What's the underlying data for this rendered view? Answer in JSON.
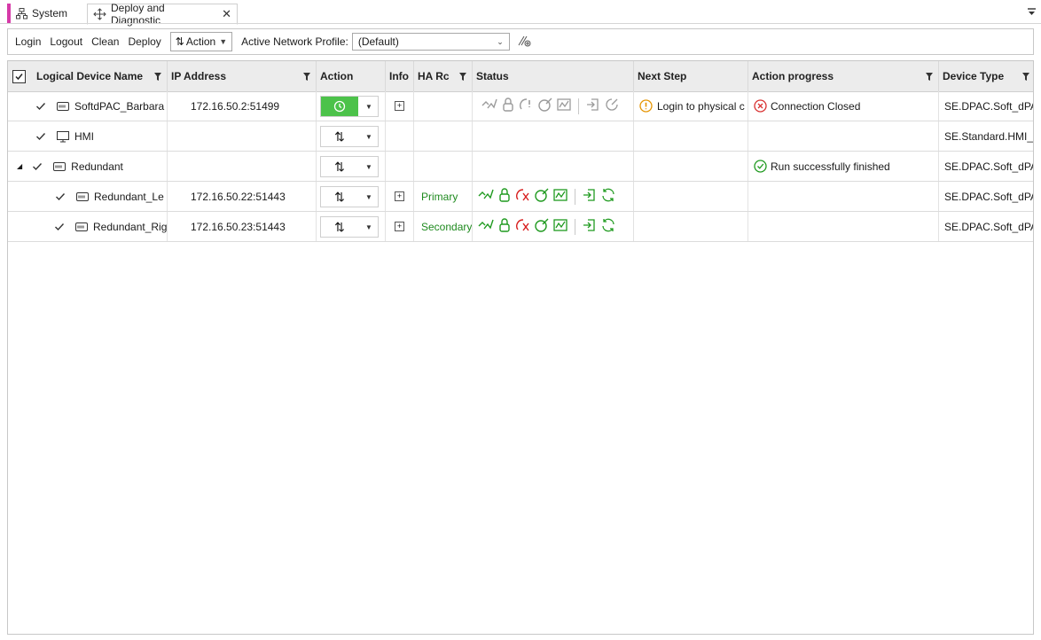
{
  "tabs": {
    "system": "System",
    "deploy": "Deploy and Diagnostic"
  },
  "toolbar": {
    "login": "Login",
    "logout": "Logout",
    "clean": "Clean",
    "deploy": "Deploy",
    "action": "Action",
    "profile_label": "Active Network Profile:",
    "profile_value": "(Default)"
  },
  "columns": {
    "name": "Logical Device Name",
    "ip": "IP Address",
    "action": "Action",
    "info": "Info",
    "ha": "HA Rc",
    "status": "Status",
    "next": "Next Step",
    "progress": "Action progress",
    "type": "Device Type"
  },
  "rows": [
    {
      "name": "SoftdPAC_Barbara",
      "ip": "172.16.50.2:51499",
      "ha": "",
      "next": "Login to physical c",
      "progress": "Connection Closed",
      "type": "SE.DPAC.Soft_dPAC"
    },
    {
      "name": "HMI",
      "ip": "",
      "ha": "",
      "next": "",
      "progress": "",
      "type": "SE.Standard.HMI_M"
    },
    {
      "name": "Redundant",
      "ip": "",
      "ha": "",
      "next": "",
      "progress": "Run successfully finished",
      "type": "SE.DPAC.Soft_dPAC"
    },
    {
      "name": "Redundant_Le",
      "ip": "172.16.50.22:51443",
      "ha": "Primary",
      "next": "",
      "progress": "",
      "type": "SE.DPAC.Soft_dPAC"
    },
    {
      "name": "Redundant_Rig",
      "ip": "172.16.50.23:51443",
      "ha": "Secondary",
      "next": "",
      "progress": "",
      "type": "SE.DPAC.Soft_dPAC"
    }
  ],
  "colors": {
    "accent_tab": "#d63aa8",
    "action_green": "#4cc24a",
    "status_green": "#1f9a1f",
    "status_red": "#d82020",
    "status_gray": "#9a9a9a",
    "warning": "#e59400",
    "error": "#d83030"
  }
}
